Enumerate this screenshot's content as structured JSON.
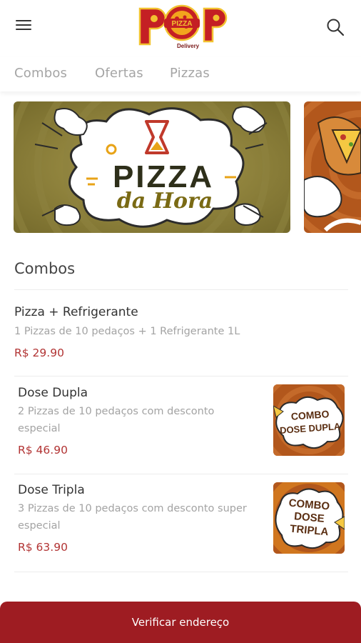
{
  "header": {
    "menu_icon": "hamburger-menu-icon",
    "logo": {
      "brand_pizza_text": "PIZZA",
      "brand_sub_text": "Delivery"
    },
    "search_icon": "search-icon"
  },
  "tabs": [
    {
      "label": "Combos"
    },
    {
      "label": "Ofertas"
    },
    {
      "label": "Pizzas"
    }
  ],
  "banners": [
    {
      "title_line1": "PIZZA",
      "title_line2": "da Hora"
    }
  ],
  "section": {
    "title": "Combos"
  },
  "items": [
    {
      "name": "Pizza + Refrigerante",
      "description": "1 Pizzas de 10 pedaços + 1 Refrigerante 1L",
      "price": "R$ 29.90"
    },
    {
      "name": "Dose Dupla",
      "description": "2 Pizzas de 10 pedaços com desconto especial",
      "price": "R$ 46.90",
      "thumb_line1": "COMBO",
      "thumb_line2": "DOSE DUPLA"
    },
    {
      "name": "Dose Tripla",
      "description": "3 Pizzas de 10 pedaços com desconto super especial",
      "price": "R$ 63.90",
      "thumb_line1": "COMBO",
      "thumb_line2": "DOSE",
      "thumb_line3": "TRIPLA"
    }
  ],
  "footer": {
    "button_label": "Verificar endereço"
  },
  "colors": {
    "brand_red": "#9e1c22",
    "price_red": "#b23434",
    "olive": "#8a7f3a",
    "orange": "#b2571c"
  }
}
